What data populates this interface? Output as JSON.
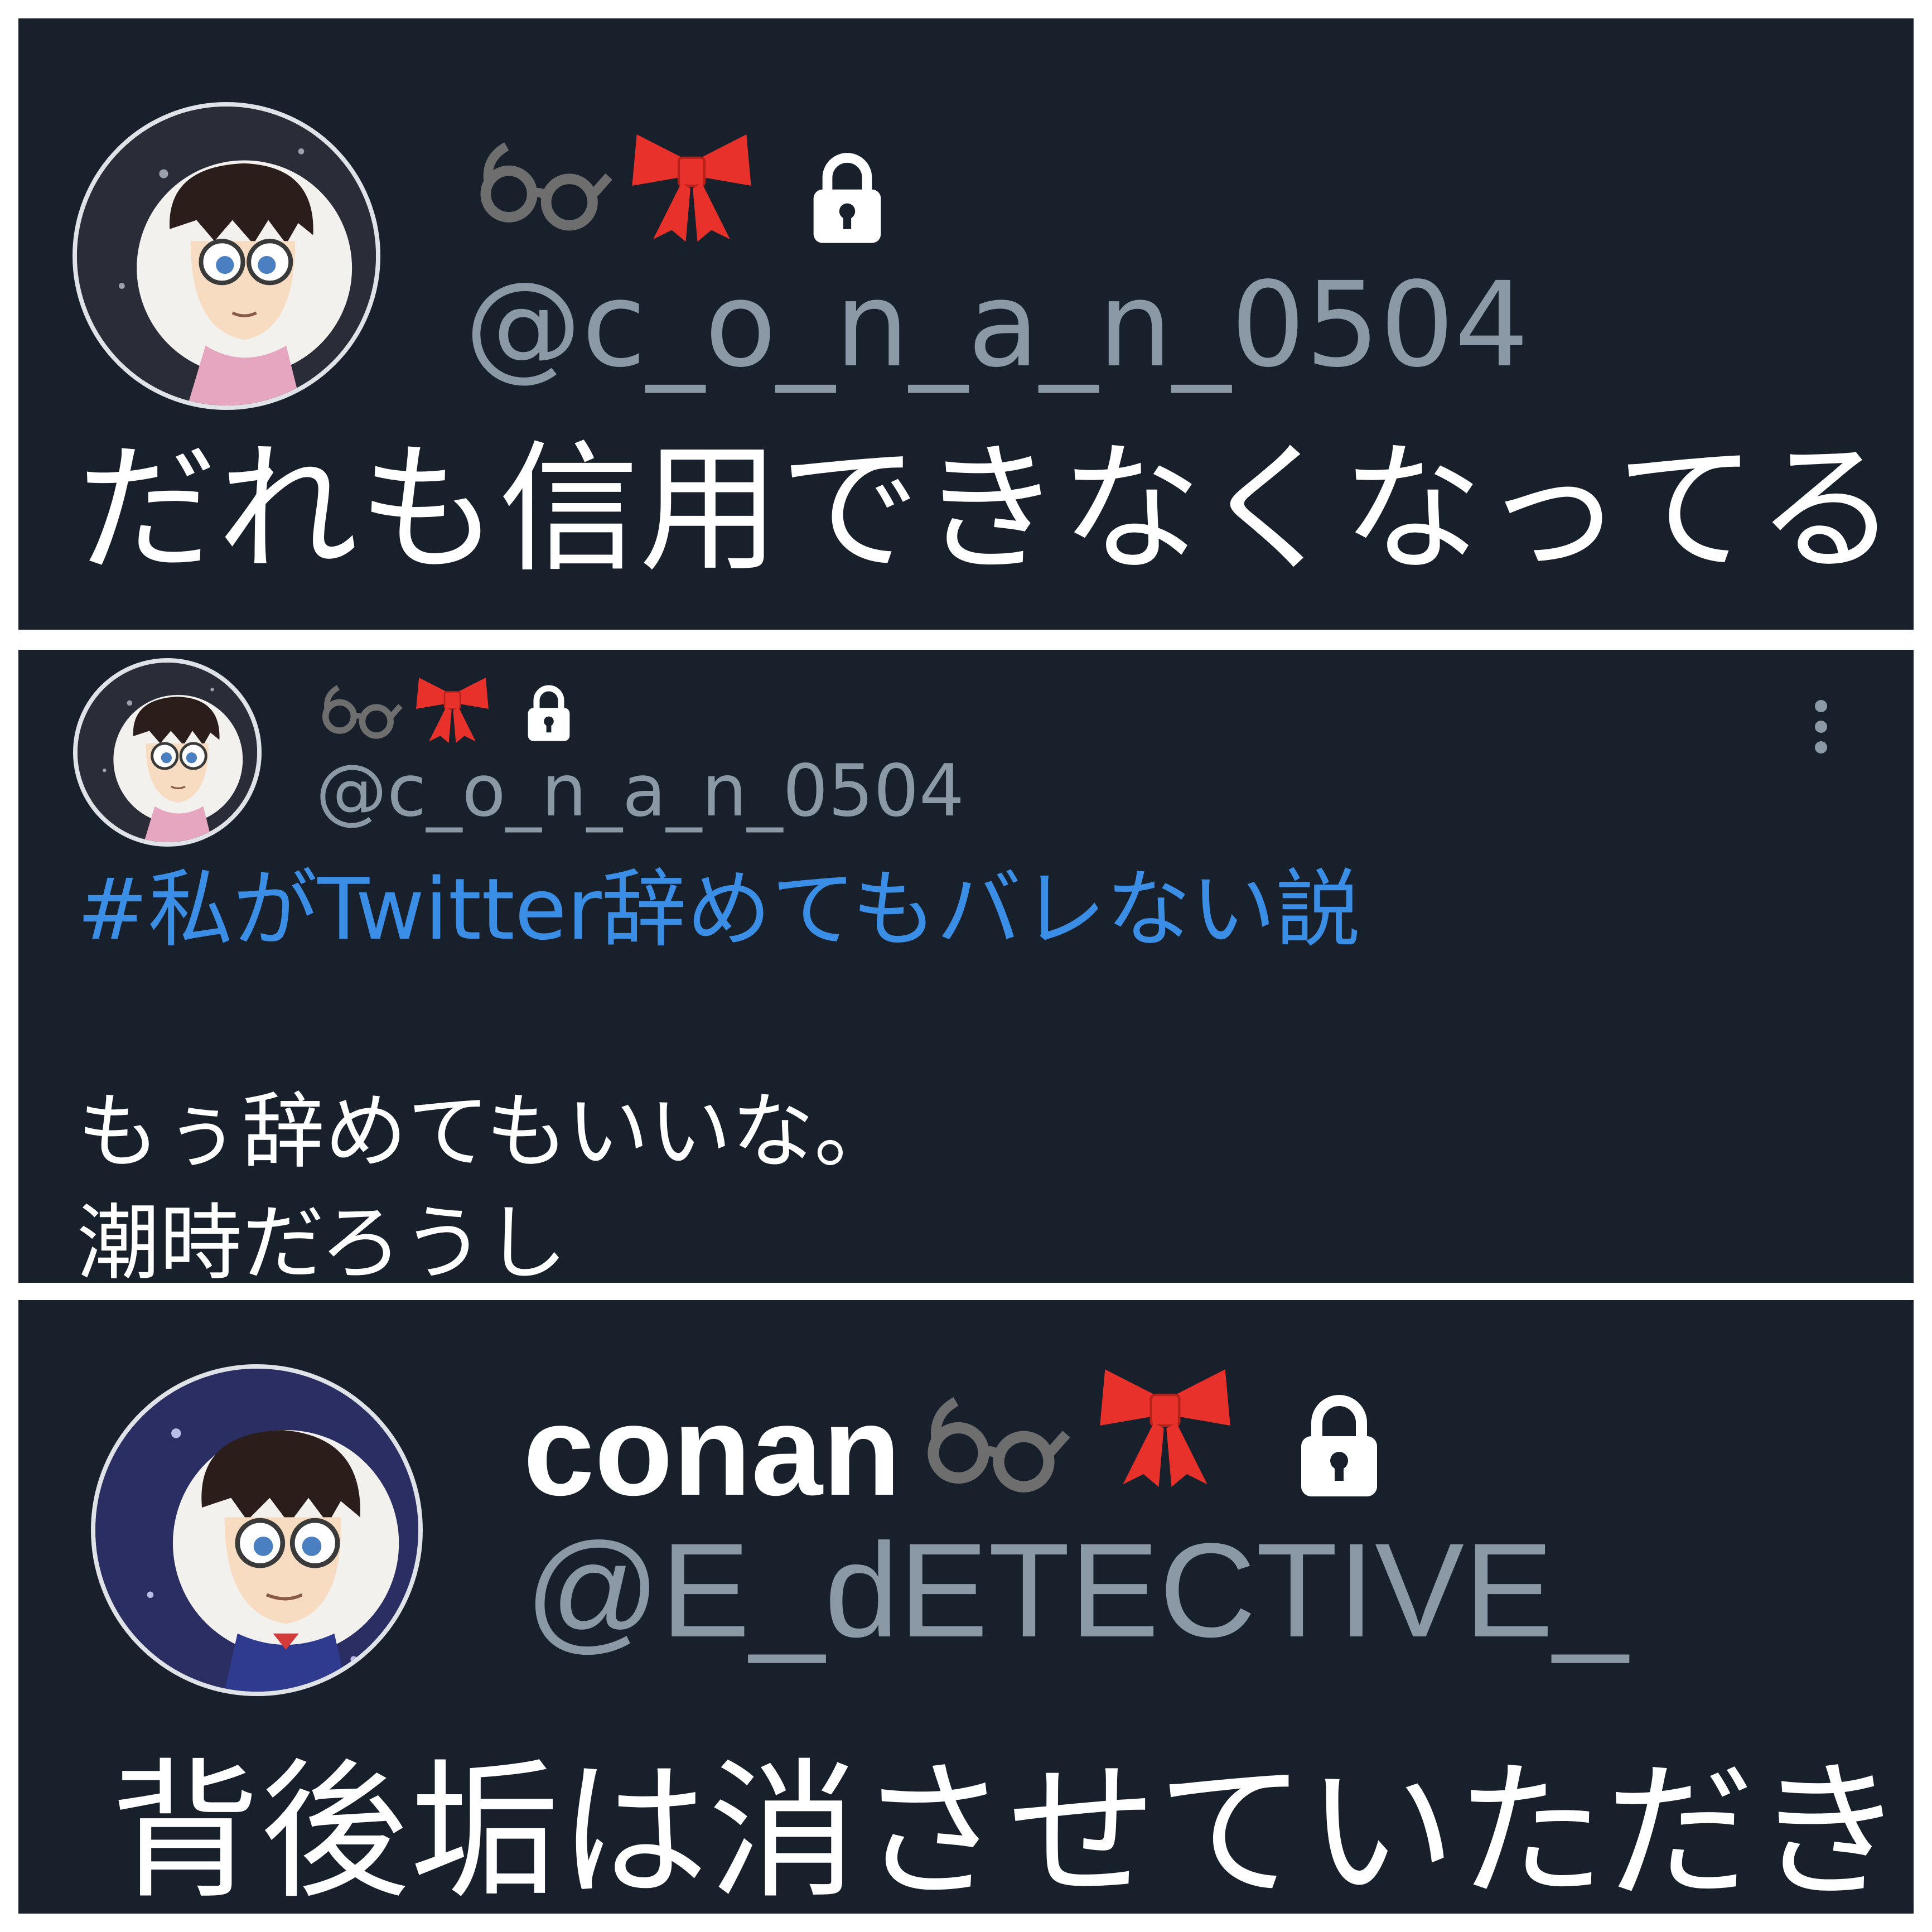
{
  "panels": [
    {
      "icons": [
        "glasses-icon",
        "ribbon-icon",
        "lock-icon"
      ],
      "handle": "@c_o_n_a_n_0504",
      "text": "だれも信用できなくなってる"
    },
    {
      "icons": [
        "glasses-icon",
        "ribbon-icon",
        "lock-icon",
        "more-options-icon"
      ],
      "handle": "@c_o_n_a_n_0504",
      "hashtag": "#私がTwitter辞めてもバレない説",
      "line1": "もぅ辞めてもいいな。",
      "line2": "潮時だろうし"
    },
    {
      "icons": [
        "glasses-icon",
        "ribbon-icon",
        "lock-icon"
      ],
      "name": "conan",
      "handle": "@E_dETECTIVE_",
      "text": "背後垢は消させていただき"
    }
  ],
  "colors": {
    "background": "#18202b",
    "handle": "#8b98a5",
    "text": "#ffffff",
    "hashtag": "#3b8ee6",
    "ribbon": "#e8312a",
    "glasses": "#6e6e6e"
  }
}
